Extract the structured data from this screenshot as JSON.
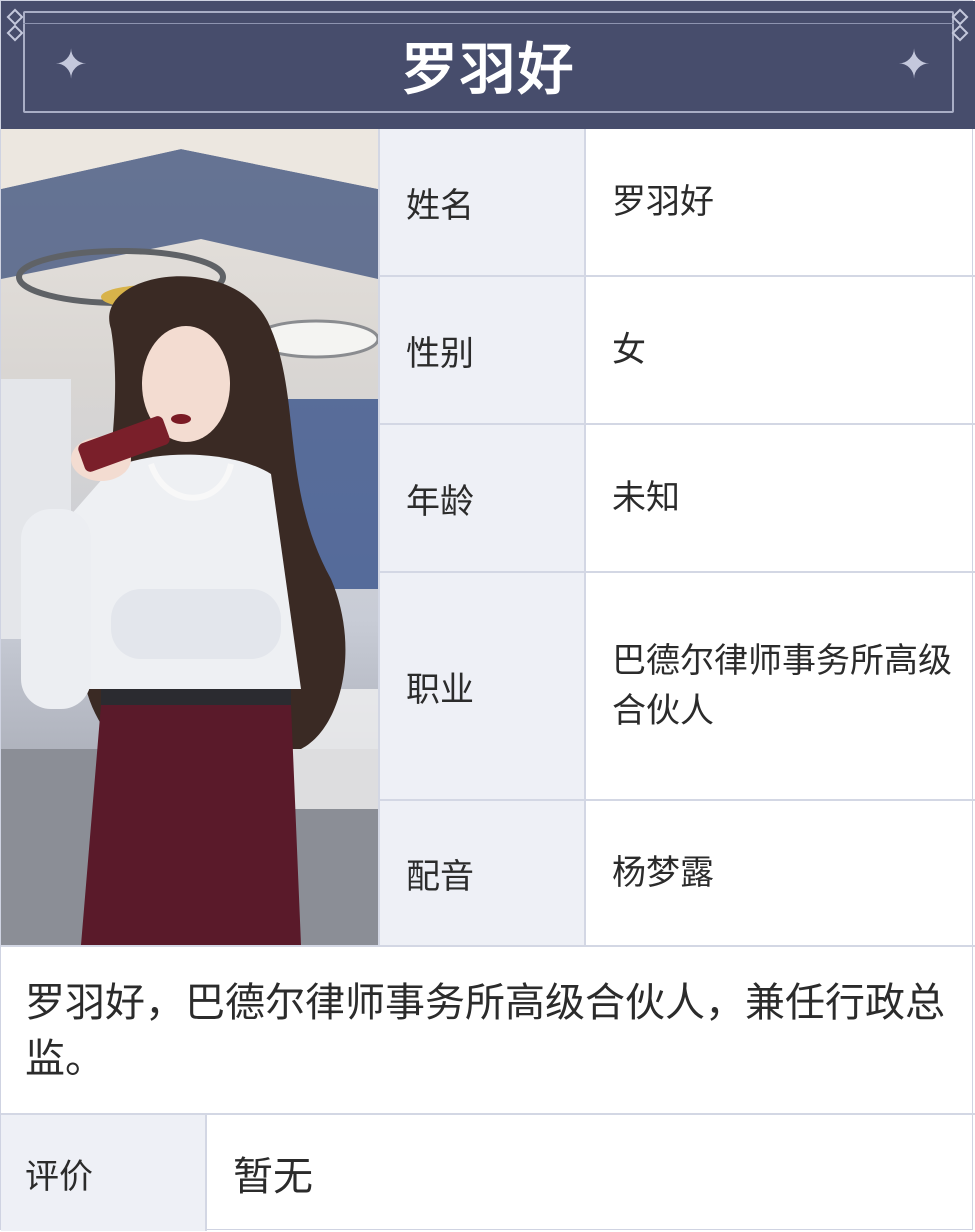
{
  "header": {
    "title": "罗羽好"
  },
  "portrait": {
    "icon": "character-portrait"
  },
  "info_rows": [
    {
      "label": "姓名",
      "value": "罗羽好"
    },
    {
      "label": "性别",
      "value": "女"
    },
    {
      "label": "年龄",
      "value": "未知"
    },
    {
      "label": "职业",
      "value": "巴德尔律师事务所高级合伙人"
    },
    {
      "label": "配音",
      "value": "杨梦露"
    }
  ],
  "description": "罗羽好，巴德尔律师事务所高级合伙人，兼任行政总监。",
  "rating": {
    "label": "评价",
    "value": "暂无"
  },
  "colors": {
    "header_bg": "#474d6c",
    "label_bg": "#eef0f6",
    "border": "#d3d7e4"
  }
}
